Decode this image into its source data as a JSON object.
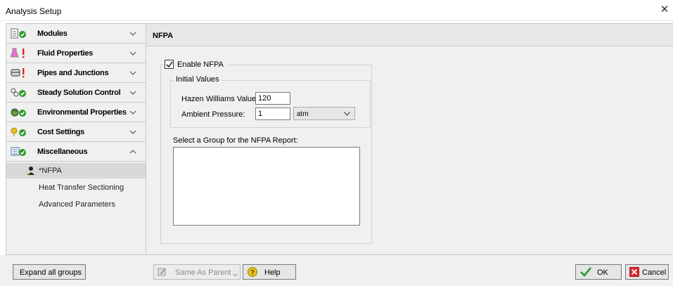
{
  "window": {
    "title": "Analysis Setup",
    "close_glyph": "✕"
  },
  "sidebar": {
    "groups": [
      {
        "label": "Modules",
        "icon": "modules-icon",
        "status": "ok",
        "expanded": false
      },
      {
        "label": "Fluid Properties",
        "icon": "flask-icon",
        "status": "error",
        "expanded": false
      },
      {
        "label": "Pipes and Junctions",
        "icon": "pipe-icon",
        "status": "error",
        "expanded": false
      },
      {
        "label": "Steady Solution Control",
        "icon": "solution-control-icon",
        "status": "ok",
        "expanded": false
      },
      {
        "label": "Environmental Properties",
        "icon": "environment-icon",
        "status": "ok",
        "expanded": false
      },
      {
        "label": "Cost Settings",
        "icon": "cost-icon",
        "status": "ok",
        "expanded": false
      },
      {
        "label": "Miscellaneous",
        "icon": "miscellaneous-icon",
        "status": "ok",
        "expanded": true
      }
    ],
    "subitems": [
      {
        "label": "*NFPA",
        "selected": true
      },
      {
        "label": "Heat Transfer Sectioning",
        "selected": false
      },
      {
        "label": "Advanced Parameters",
        "selected": false
      }
    ]
  },
  "panel": {
    "title": "NFPA",
    "enable_label": "Enable NFPA",
    "enable_checked": true,
    "initial_values": {
      "legend": "Initial Values",
      "hazen_label": "Hazen Williams Value:",
      "hazen_value": "120",
      "ambient_label": "Ambient Pressure:",
      "ambient_value": "1",
      "ambient_unit": "atm"
    },
    "group_label": "Select a Group for the NFPA Report:"
  },
  "footer": {
    "expand_label": "Expand all groups",
    "same_as_parent_label": "Same As Parent",
    "help_label": "Help",
    "ok_label": "OK",
    "cancel_label": "Cancel"
  },
  "colors": {
    "ok_green": "#2a9a2a",
    "error_red": "#d9262c",
    "panel_bg": "#f0f0f0"
  }
}
